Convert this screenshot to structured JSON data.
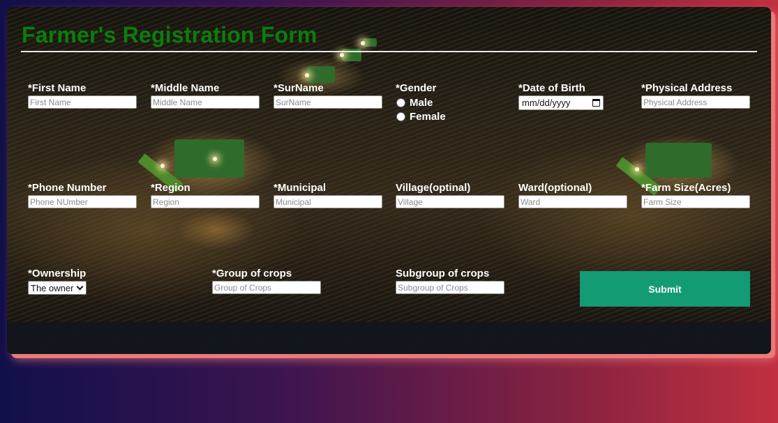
{
  "form": {
    "title": "Farmer's Registration Form",
    "first_name": {
      "label": "*First Name",
      "placeholder": "First Name"
    },
    "middle_name": {
      "label": "*Middle Name",
      "placeholder": "Middle Name"
    },
    "surname": {
      "label": "*SurName",
      "placeholder": "SurName"
    },
    "gender": {
      "label": "*Gender",
      "options": [
        "Male",
        "Female"
      ]
    },
    "dob": {
      "label": "*Date of Birth",
      "placeholder": "mm/dd/yyyy",
      "icon": "calendar-icon"
    },
    "physical_address": {
      "label": "*Physical Address",
      "placeholder": "Physical Address"
    },
    "phone": {
      "label": "*Phone Number",
      "placeholder": "Phone NUmber"
    },
    "region": {
      "label": "*Region",
      "placeholder": "Region"
    },
    "municipal": {
      "label": "*Municipal",
      "placeholder": "Municipal"
    },
    "village": {
      "label": "Village(optinal)",
      "placeholder": "Village"
    },
    "ward": {
      "label": "Ward(optional)",
      "placeholder": "Ward"
    },
    "farm_size": {
      "label": "*Farm Size(Acres)",
      "placeholder": "Farm Size"
    },
    "ownership": {
      "label": "*Ownership",
      "selected": "The owner",
      "icon": "chevron-down-icon"
    },
    "group_crops": {
      "label": "*Group of crops",
      "placeholder": "Group of Crops"
    },
    "subgroup_crops": {
      "label": "Subgroup of crops",
      "placeholder": "Subgroup of Crops"
    },
    "submit_label": "Submit"
  },
  "colors": {
    "title": "#0b7d0b",
    "submit": "#139b73",
    "label": "#ffffff"
  }
}
